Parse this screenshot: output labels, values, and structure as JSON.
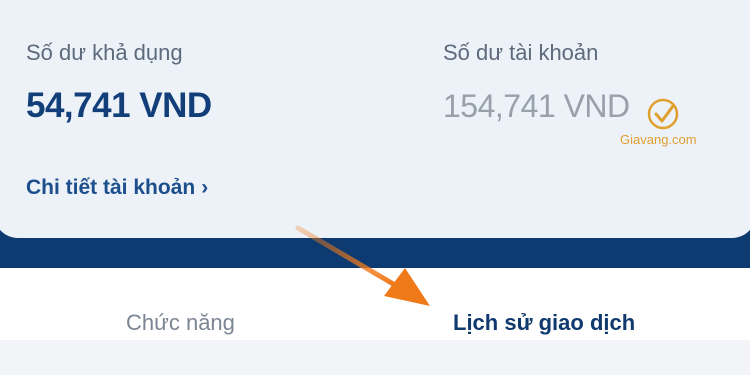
{
  "balance": {
    "available_label": "Số dư khả dụng",
    "available_amount": "54,741 VND",
    "account_label": "Số dư tài khoản",
    "account_amount": "154,741 VND",
    "detail_link": "Chi tiết tài khoản",
    "chevron": "›"
  },
  "watermark": {
    "text": "Giavang.com",
    "icon": "gold-check-logo-icon"
  },
  "tabs": [
    {
      "label": "Chức năng",
      "active": false
    },
    {
      "label": "Lịch sử giao dịch",
      "active": true
    }
  ],
  "annotation": {
    "icon": "orange-arrow-icon",
    "color": "#f07a1a"
  },
  "colors": {
    "brand_navy": "#0d3a70",
    "card_bg": "#edf2f9",
    "accent_orange": "#f07a1a"
  }
}
